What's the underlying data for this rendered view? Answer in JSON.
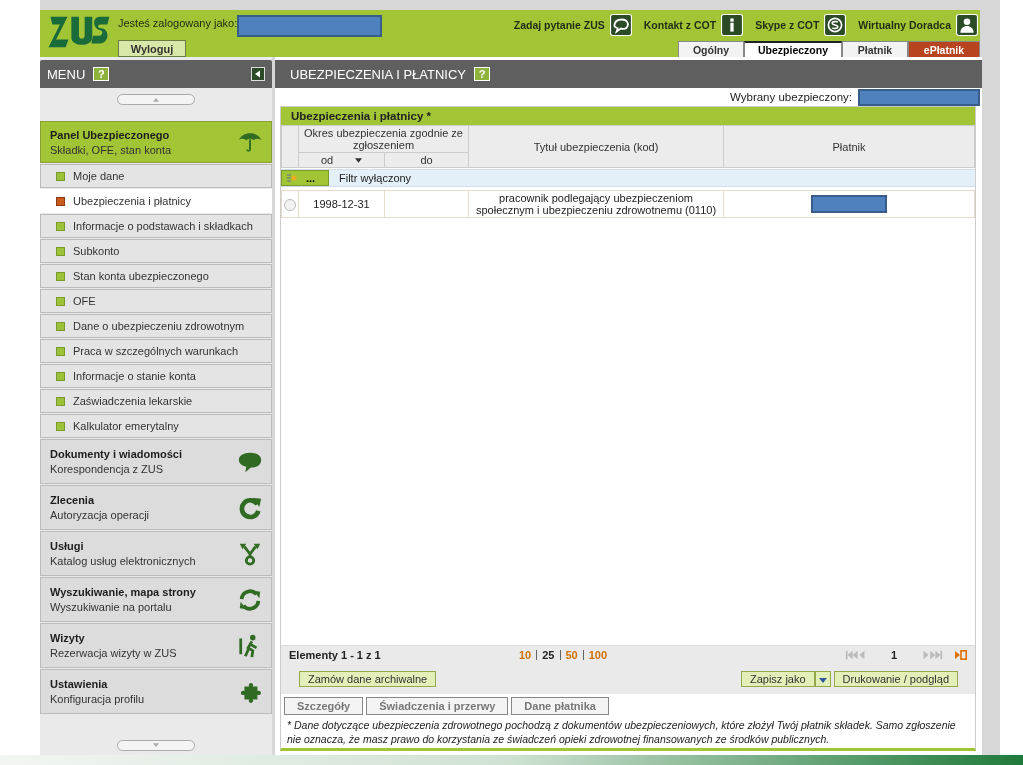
{
  "header": {
    "logged_in_label": "Jesteś zalogowany jako:",
    "logout": "Wyloguj",
    "links": [
      {
        "label": "Zadaj pytanie ZUS",
        "kind": "chat"
      },
      {
        "label": "Kontakt z COT",
        "kind": "info"
      },
      {
        "label": "Skype z COT",
        "kind": "skype"
      },
      {
        "label": "Wirtualny Doradca",
        "kind": "person"
      }
    ],
    "tabs": [
      {
        "label": "Ogólny",
        "selected": false,
        "kind": "normal"
      },
      {
        "label": "Ubezpieczony",
        "selected": true,
        "kind": "normal"
      },
      {
        "label": "Płatnik",
        "selected": false,
        "kind": "normal"
      },
      {
        "label": "ePłatnik",
        "selected": false,
        "kind": "accent"
      }
    ]
  },
  "sidebar": {
    "title": "MENU",
    "help": "?",
    "sections": [
      {
        "title": "Panel Ubezpieczonego",
        "subtitle": "Składki, OFE, stan konta",
        "kind": "umbrella",
        "expanded": true,
        "items": [
          {
            "label": "Moje dane",
            "selected": false
          },
          {
            "label": "Ubezpieczenia i płatnicy",
            "selected": true
          },
          {
            "label": "Informacje o podstawach i składkach",
            "selected": false
          },
          {
            "label": "Subkonto",
            "selected": false
          },
          {
            "label": "Stan konta ubezpieczonego",
            "selected": false
          },
          {
            "label": "OFE",
            "selected": false
          },
          {
            "label": "Dane o ubezpieczeniu zdrowotnym",
            "selected": false
          },
          {
            "label": "Praca w szczególnych warunkach",
            "selected": false
          },
          {
            "label": "Informacje o stanie konta",
            "selected": false
          },
          {
            "label": "Zaświadczenia lekarskie",
            "selected": false
          },
          {
            "label": "Kalkulator emerytalny",
            "selected": false
          }
        ]
      },
      {
        "title": "Dokumenty i wiadomości",
        "subtitle": "Korespondencja z ZUS",
        "kind": "speech",
        "expanded": false
      },
      {
        "title": "Zlecenia",
        "subtitle": "Autoryzacja operacji",
        "kind": "refresh",
        "expanded": false
      },
      {
        "title": "Usługi",
        "subtitle": "Katalog usług elektronicznych",
        "kind": "fork",
        "expanded": false
      },
      {
        "title": "Wyszukiwanie, mapa strony",
        "subtitle": "Wyszukiwanie na portalu",
        "kind": "sync",
        "expanded": false
      },
      {
        "title": "Wizyty",
        "subtitle": "Rezerwacja wizyty w ZUS",
        "kind": "walker",
        "expanded": false
      },
      {
        "title": "Ustawienia",
        "subtitle": "Konfiguracja profilu",
        "kind": "puzzle",
        "expanded": false
      }
    ]
  },
  "main": {
    "title": "UBEZPIECZENIA I PŁATNICY",
    "help": "?",
    "selected_insured_label": "Wybrany ubezpieczony:",
    "grid": {
      "title": "Ubezpieczenia i płatnicy *",
      "period_header": "Okres ubezpieczenia zgodnie ze zgłoszeniem",
      "from_header": "od",
      "to_header": "do",
      "title_header": "Tytuł ubezpieczenia (kod)",
      "payer_header": "Płatnik",
      "filter_button": "...",
      "filter_label": "Filtr wyłączony",
      "rows": [
        {
          "selected": false,
          "from": "1998-12-31",
          "title": "pracownik podlegający ubezpieczeniom społecznym i ubezpieczeniu zdrowotnemu (0110)"
        }
      ],
      "elements": "Elementy 1 - 1 z 1",
      "page_sizes": [
        {
          "label": "10",
          "selected": false
        },
        {
          "label": "25",
          "selected": true
        },
        {
          "label": "50",
          "selected": false
        },
        {
          "label": "100",
          "selected": false
        }
      ],
      "page": "1"
    },
    "order_button": "Zamów dane archiwalne",
    "save_as_button": "Zapisz jako",
    "print_button": "Drukowanie / podgląd",
    "detail_buttons": [
      "Szczegóły",
      "Świadczenia i przerwy",
      "Dane płatnika"
    ],
    "note": "* Dane dotyczące ubezpieczenia zdrowotnego pochodzą z dokumentów ubezpieczeniowych, które złożył Twój płatnik składek. Samo zgłoszenie nie oznacza, że masz prawo do korzystania ze świadczeń opieki zdrowotnej finansowanych ze środków publicznych."
  }
}
